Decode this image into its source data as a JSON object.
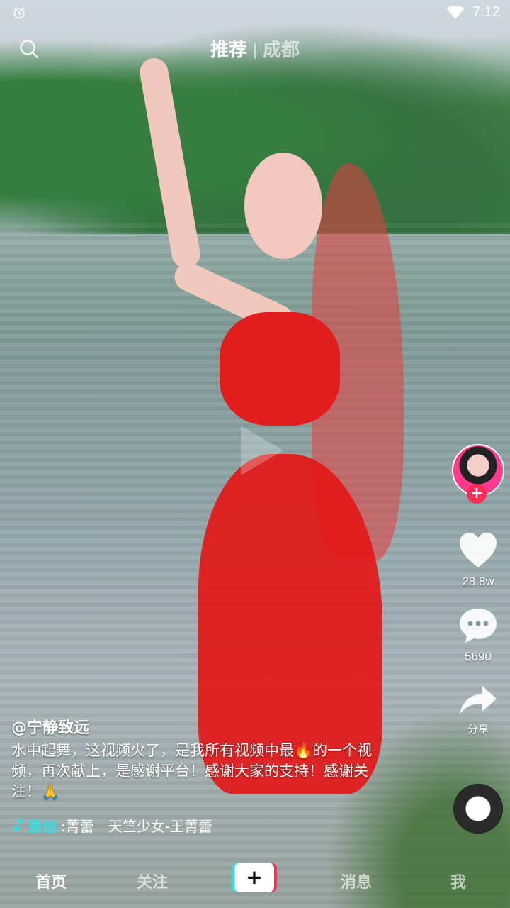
{
  "status_bar": {
    "time": "7:12",
    "icons": [
      "alarm-icon",
      "wifi-icon"
    ]
  },
  "top_nav": {
    "tabs": [
      {
        "label": "推荐",
        "active": true
      },
      {
        "label": "成都",
        "active": false
      }
    ],
    "search_icon": "search-icon"
  },
  "video": {
    "author": "@宁静致远",
    "description": "水中起舞，这视频火了，是我所有视频中最🔥的一个视频，再次献上，是感谢平台！感谢大家的支持！感谢关注！🙏"
  },
  "music": {
    "tag": "原创",
    "song": ":菁蕾　天竺少女-王菁蕾"
  },
  "actions": {
    "likes": "28.8w",
    "comments": "5690",
    "share_label": "分享"
  },
  "bottom_nav": {
    "home": "首页",
    "follow": "关注",
    "add": "+",
    "messages": "消息",
    "me": "我"
  },
  "colors": {
    "accent_cyan": "#2ce1e8",
    "accent_red": "#fe2c55"
  }
}
